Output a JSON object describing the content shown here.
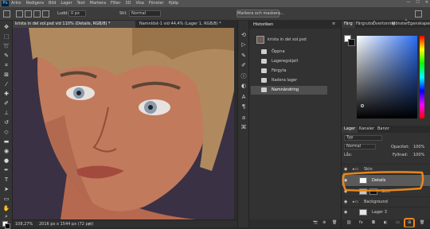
{
  "app": {
    "logo": "Ps",
    "menu": [
      "Arkiv",
      "Redigera",
      "Bild",
      "Lager",
      "Text",
      "Markera",
      "Filter",
      "3D",
      "Visa",
      "Fönster",
      "Hjälp"
    ]
  },
  "options": {
    "feather_label": "Ludd:",
    "feather_value": "0 px",
    "style_label": "Stil:",
    "style_value": "Normal",
    "mask_button": "Markera och maskera..."
  },
  "tabs": [
    {
      "label": "krista in del xol.psd vid 110% (Details, RGB/8) *",
      "active": true
    },
    {
      "label": "Namnlöst-1 vid 44,4% (Lager 1, RGB/8) *",
      "active": false
    }
  ],
  "status": {
    "zoom": "108,27%",
    "doc_size": "2016 px x 1544 px (72 ppi)"
  },
  "history": {
    "title": "Historiken",
    "snapshot": "krista in del xol.psd",
    "items": [
      {
        "label": "Öppna",
        "selected": false
      },
      {
        "label": "Lageregskjell",
        "selected": false
      },
      {
        "label": "Färgyta",
        "selected": false
      },
      {
        "label": "Radera lager",
        "selected": false
      },
      {
        "label": "Namnändring",
        "selected": true
      }
    ]
  },
  "color_panel": {
    "tabs": [
      "Färg",
      "Färgrutor",
      "Övertoning",
      "Mönster",
      "Egenskaper"
    ],
    "foreground": "#ffffff",
    "background": "#111111"
  },
  "layers_panel": {
    "tabs": [
      "Lager",
      "Kanaler",
      "Banor"
    ],
    "filter_placeholder": "Typ",
    "blend_mode": "Normal",
    "opacity_label": "Opacitet:",
    "opacity_value": "100%",
    "lock_label": "Lås:",
    "fill_label": "Fyllnad:",
    "fill_value": "100%",
    "layers": [
      {
        "name": "Skin",
        "kind": "group",
        "selected": false
      },
      {
        "name": "Details",
        "kind": "layer",
        "selected": true
      },
      {
        "name": "Skin",
        "kind": "masked",
        "selected": false
      },
      {
        "name": "Background",
        "kind": "group",
        "selected": false
      },
      {
        "name": "Lager 3",
        "kind": "layer",
        "selected": false
      }
    ]
  },
  "colors": {
    "highlight_orange": "#e8861a",
    "panel_bg": "#323232",
    "canvas_bg": "#3a3144"
  }
}
